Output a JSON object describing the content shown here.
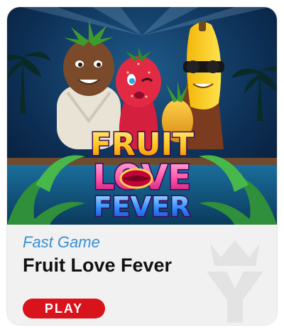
{
  "game": {
    "category": "Fast Game",
    "title": "Fruit Love Fever",
    "play_label": "PLAY",
    "logo_words": [
      "FRUIT",
      "LOVE",
      "FEVER"
    ]
  },
  "icons": {
    "watermark": "crown-y-watermark-icon"
  },
  "colors": {
    "card_bg": "#f1f1f1",
    "category_text": "#3a8fd3",
    "title_text": "#111111",
    "play_button": "#d8131c",
    "logo_yellow": "#ffc21a",
    "logo_pink": "#ff4fa3",
    "logo_blue": "#2e8bff"
  }
}
